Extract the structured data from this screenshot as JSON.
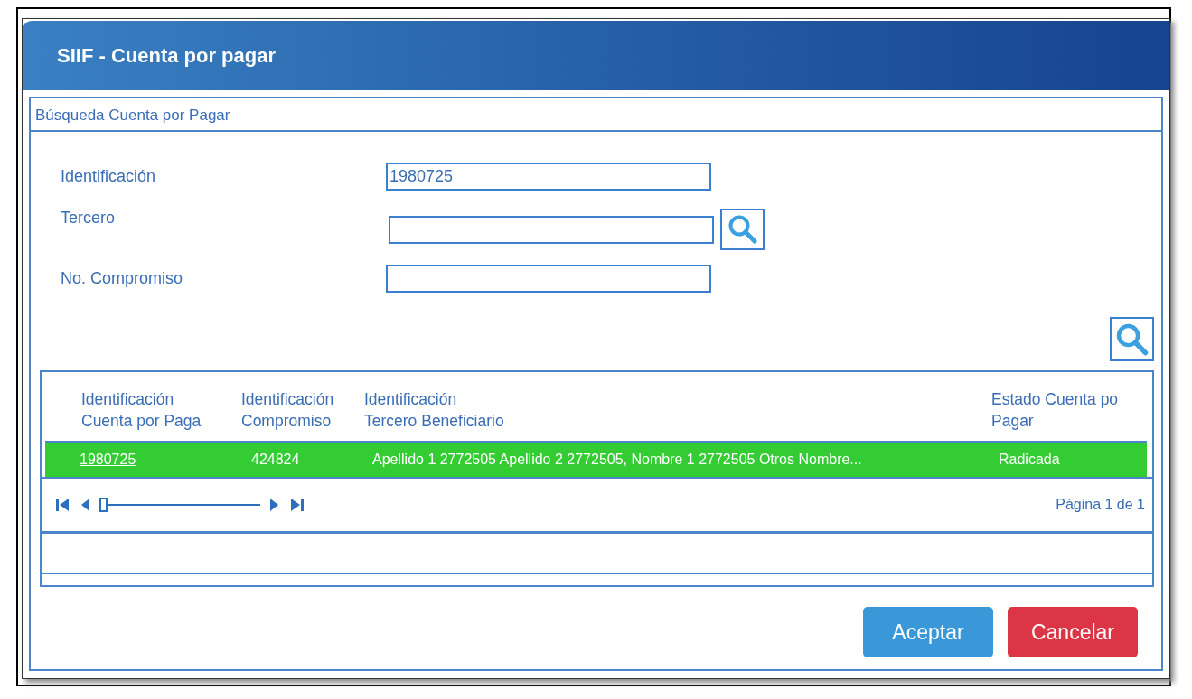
{
  "window": {
    "title": "SIIF - Cuenta por pagar"
  },
  "panel": {
    "title": "Búsqueda Cuenta por Pagar"
  },
  "form": [
    {
      "label": "Identificación",
      "value": "1980725",
      "kind": "plain"
    },
    {
      "label": "Tercero",
      "kind": "lookup"
    },
    {
      "label": "No. Compromiso",
      "kind": "plain"
    }
  ],
  "table": {
    "columns": [
      "Identificación\nCuenta por Paga",
      "Identificación\nCompromiso",
      "Identificación\nTercero Beneficiario",
      "Estado Cuenta po\nPagar"
    ],
    "rows": [
      {
        "selected": true,
        "cells": [
          "1980725",
          "424824",
          "Apellido 1 2772505 Apellido 2 2772505, Nombre 1 2772505 Otros Nombre...",
          "Radicada"
        ]
      }
    ]
  },
  "pager": {
    "level": 0,
    "text": "Página 1 de 1"
  },
  "buttons": [
    {
      "label": "Aceptar",
      "kind": "primary"
    },
    {
      "label": "Cancelar",
      "kind": "danger"
    }
  ]
}
